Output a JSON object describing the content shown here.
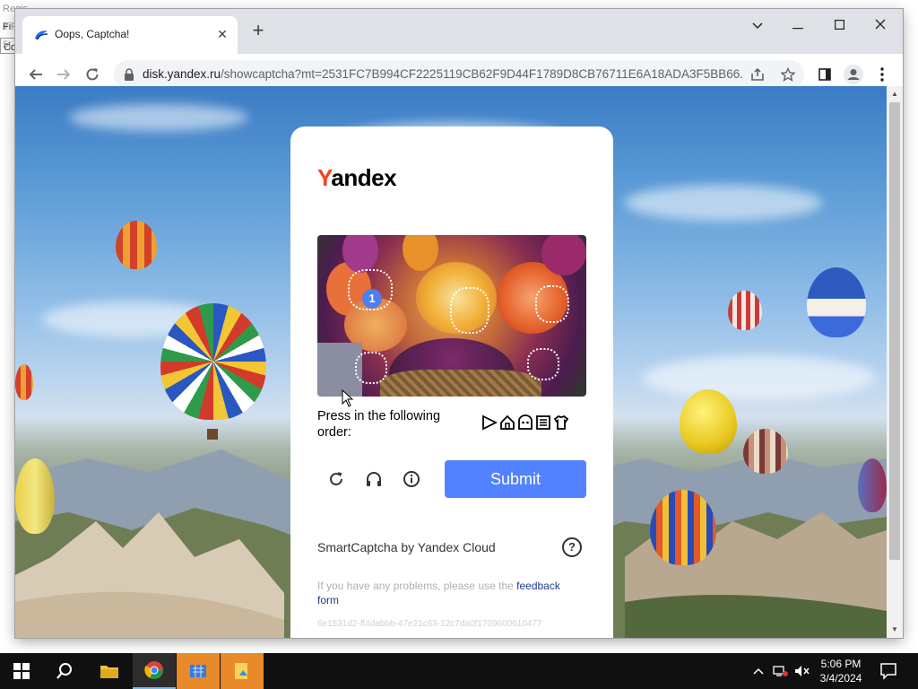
{
  "behind_app": {
    "line1": "Regis ir F-5t",
    "line2": "Fi",
    "line3": "Co"
  },
  "browser": {
    "tab_title": "Oops, Captcha!",
    "url_host": "disk.yandex.ru",
    "url_path": "/showcaptcha?mt=2531FC7B994CF2225119CB62F9D44F1789D8CB76711E6A18ADA3F5BB66..."
  },
  "captcha": {
    "logo_y": "Y",
    "logo_rest": "andex",
    "marker_number": "1",
    "instruction": "Press in the following order:",
    "order_icons": [
      "play-triangle-icon",
      "house-icon",
      "face-icon",
      "shirt-tag-icon",
      "tshirt-icon"
    ],
    "submit_label": "Submit",
    "brand_line": "SmartCaptcha by Yandex Cloud",
    "help_label": "?",
    "feedback_prefix": "If you have any problems, please use the ",
    "feedback_link": "feedback form",
    "hash": "6e1531d2-ff4dabbb-47e21c63-12c7da0f1709600610477",
    "accent_color": "#5282ff",
    "logo_accent": "#fc3f1d"
  },
  "taskbar": {
    "time": "5:06 PM",
    "date": "3/4/2024"
  }
}
